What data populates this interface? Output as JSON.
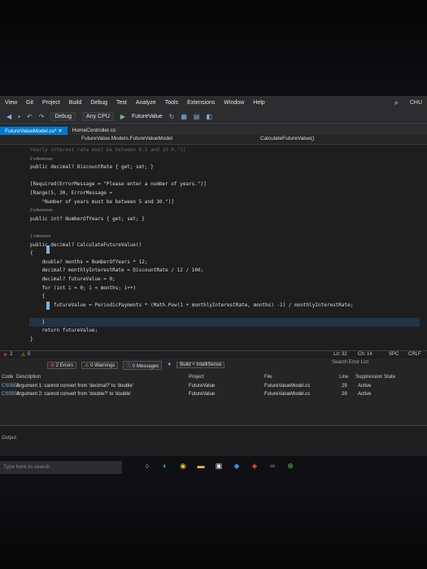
{
  "menu": {
    "items": [
      "View",
      "Git",
      "Project",
      "Build",
      "Debug",
      "Test",
      "Analyze",
      "Tools",
      "Extensions",
      "Window",
      "Help"
    ],
    "right_label": "CHU"
  },
  "toolbar": {
    "config": "Debug",
    "platform": "Any CPU",
    "run_target": "FutureValue"
  },
  "tabs": [
    {
      "label": "FutureValueModel.cs*"
    },
    {
      "label": "HomeController.cs"
    }
  ],
  "navbar": {
    "class_path": "FutureValue.Models.FutureValueModel",
    "member": "CalculateFutureValue()"
  },
  "code_lines": [
    {
      "type": "faded",
      "text": "Yearly interest rate must be between 0.1 and 10.0.\")]"
    },
    {
      "type": "ref",
      "text": "2 references"
    },
    {
      "type": "code",
      "text": "public decimal? DiscountRate { get; set; }"
    },
    {
      "type": "blank",
      "text": ""
    },
    {
      "type": "code",
      "text": "[Required(ErrorMessage = \"Please enter a number of years.\")]"
    },
    {
      "type": "code",
      "text": "[Range(5, 30, ErrorMessage ="
    },
    {
      "type": "code",
      "text": "    \"Number of years must be between 5 and 30.\")]"
    },
    {
      "type": "ref",
      "text": "3 references"
    },
    {
      "type": "code",
      "text": "public int? NumberOfYears { get; set; }"
    },
    {
      "type": "blank",
      "text": ""
    },
    {
      "type": "ref",
      "text": "1 reference"
    },
    {
      "type": "code",
      "text": "public decimal? CalculateFutureValue()"
    },
    {
      "type": "code",
      "text": "{"
    },
    {
      "type": "code",
      "text": "    double? months = NumberOfYears * 12;"
    },
    {
      "type": "code",
      "text": "    decimal? monthlyInterestRate = DiscountRate / 12 / 100;"
    },
    {
      "type": "code",
      "text": "    decimal? futureValue = 0;"
    },
    {
      "type": "code",
      "text": "    for (int i = 0; i < months; i++)"
    },
    {
      "type": "code",
      "text": "    {"
    },
    {
      "type": "code",
      "text": "        futureValue = PeriodicPayments * (Math.Pow(1 + monthlyInterestRate, months) -1) / monthlyInterestRate;"
    },
    {
      "type": "blank",
      "text": ""
    },
    {
      "type": "code",
      "text": "    }"
    },
    {
      "type": "code",
      "text": "    return futureValue;"
    },
    {
      "type": "code",
      "text": "}"
    }
  ],
  "status": {
    "errors_count": "2",
    "warnings_count": "0",
    "line": "Ln: 32",
    "col": "Ch: 14",
    "mode": "SPC",
    "eol": "CRLF"
  },
  "error_list": {
    "filter_errors": "2 Errors",
    "filter_warnings": "0 Warnings",
    "filter_messages": "0 Messages",
    "scope": "Build + IntelliSense",
    "search_placeholder": "Search Error List",
    "headers": {
      "code": "Code",
      "description": "Description",
      "project": "Project",
      "file": "File",
      "line": "Line",
      "suppression": "Suppression State"
    },
    "rows": [
      {
        "code": "CS0503",
        "description": "Argument 1: cannot convert from 'decimal?' to 'double'",
        "project": "FutureValue",
        "file": "FutureValueModel.cs",
        "line": "29",
        "state": "Active"
      },
      {
        "code": "CS0503",
        "description": "Argument 2: cannot convert from 'double?' to 'double'",
        "project": "FutureValue",
        "file": "FutureValueModel.cs",
        "line": "29",
        "state": "Active"
      }
    ]
  },
  "output": {
    "label": "Output"
  },
  "taskbar": {
    "search_placeholder": "Type here to search"
  }
}
